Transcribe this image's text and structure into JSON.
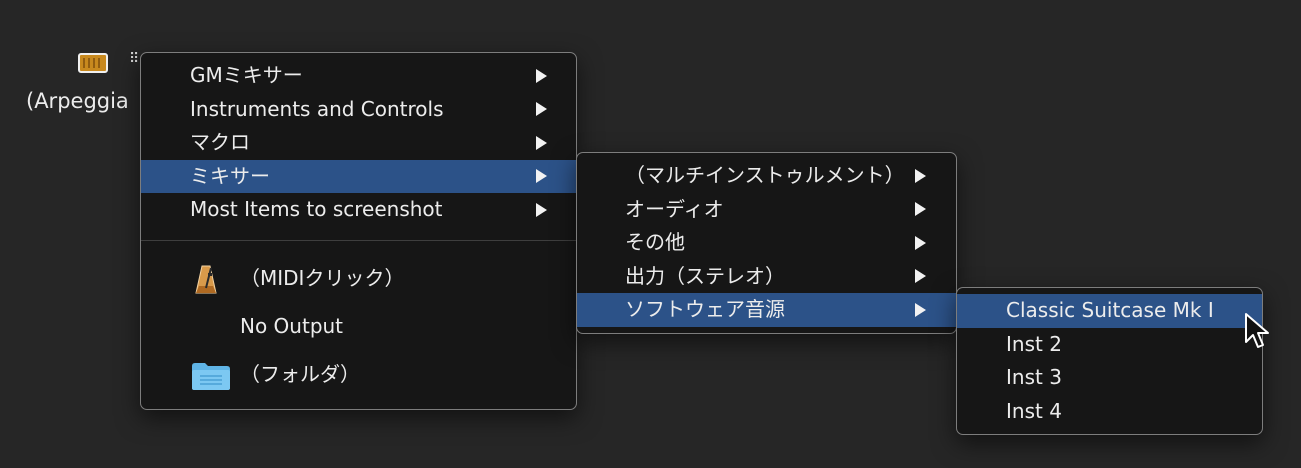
{
  "background": {
    "track_label": "(Arpeggia",
    "grid_glyph": "⠿"
  },
  "main_menu": {
    "items": [
      {
        "label": "GMミキサー",
        "submenu": true,
        "selected": false
      },
      {
        "label": "Instruments and Controls",
        "submenu": true,
        "selected": false
      },
      {
        "label": "マクロ",
        "submenu": true,
        "selected": false
      },
      {
        "label": "ミキサー",
        "submenu": true,
        "selected": true
      },
      {
        "label": "Most Items to screenshot",
        "submenu": true,
        "selected": false
      }
    ],
    "lower_items": [
      {
        "label": "（MIDIクリック）",
        "icon": "metronome-icon"
      },
      {
        "label": "No Output",
        "icon": ""
      },
      {
        "label": "（フォルダ）",
        "icon": "folder-icon"
      }
    ]
  },
  "mixer_submenu": {
    "items": [
      {
        "label": "（マルチインストゥルメント）",
        "submenu": true,
        "selected": false
      },
      {
        "label": "オーディオ",
        "submenu": true,
        "selected": false
      },
      {
        "label": "その他",
        "submenu": true,
        "selected": false
      },
      {
        "label": "出力（ステレオ）",
        "submenu": true,
        "selected": false
      },
      {
        "label": "ソフトウェア音源",
        "submenu": true,
        "selected": true
      }
    ]
  },
  "software_submenu": {
    "items": [
      {
        "label": "Classic Suitcase Mk I",
        "selected": true
      },
      {
        "label": "Inst 2",
        "selected": false
      },
      {
        "label": "Inst 3",
        "selected": false
      },
      {
        "label": "Inst 4",
        "selected": false
      }
    ]
  },
  "colors": {
    "background": "#262626",
    "menu_bg": "#161616",
    "menu_border": "#7d7d7d",
    "highlight": "#2c5288",
    "text": "#ececec"
  },
  "icons": [
    "keyboard-instrument-icon",
    "grid-handle-icon",
    "submenu-arrow-icon",
    "metronome-icon",
    "folder-icon",
    "mouse-pointer-icon"
  ]
}
